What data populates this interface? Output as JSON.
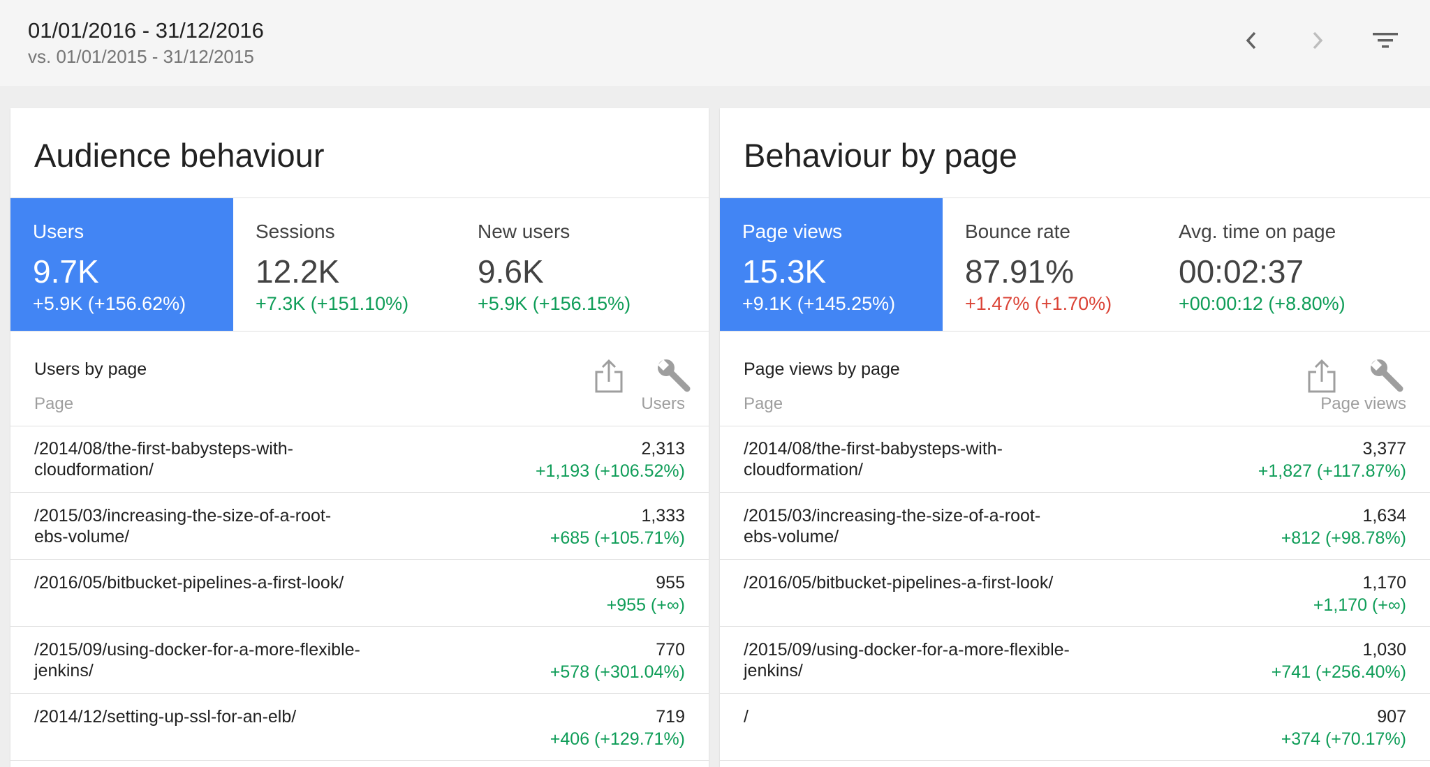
{
  "header": {
    "date_range": "01/01/2016 - 31/12/2016",
    "compare_range": "vs. 01/01/2015 - 31/12/2015",
    "icons": [
      "chevron-left-icon",
      "chevron-right-icon",
      "filter-icon"
    ]
  },
  "colors": {
    "accent": "#4285f4",
    "positive": "#0f9d58",
    "negative": "#db4437"
  },
  "audience": {
    "title": "Audience behaviour",
    "metrics": [
      {
        "label": "Users",
        "value": "9.7K",
        "delta": "+5.9K (+156.62%)"
      },
      {
        "label": "Sessions",
        "value": "12.2K",
        "delta": "+7.3K (+151.10%)"
      },
      {
        "label": "New users",
        "value": "9.6K",
        "delta": "+5.9K (+156.15%)"
      }
    ],
    "table": {
      "title": "Users by page",
      "col_left": "Page",
      "col_right": "Users",
      "rows": [
        {
          "page": "/2014/08/the-first-babysteps-with-cloudformation/",
          "value": "2,313",
          "delta": "+1,193 (+106.52%)"
        },
        {
          "page": "/2015/03/increasing-the-size-of-a-root-ebs-volume/",
          "value": "1,333",
          "delta": "+685 (+105.71%)"
        },
        {
          "page": "/2016/05/bitbucket-pipelines-a-first-look/",
          "value": "955",
          "delta": "+955 (+∞)"
        },
        {
          "page": "/2015/09/using-docker-for-a-more-flexible-jenkins/",
          "value": "770",
          "delta": "+578 (+301.04%)"
        },
        {
          "page": "/2014/12/setting-up-ssl-for-an-elb/",
          "value": "719",
          "delta": "+406 (+129.71%)"
        }
      ]
    }
  },
  "behaviour": {
    "title": "Behaviour by page",
    "metrics": [
      {
        "label": "Page views",
        "value": "15.3K",
        "delta": "+9.1K (+145.25%)"
      },
      {
        "label": "Bounce rate",
        "value": "87.91%",
        "delta": "+1.47% (+1.70%)"
      },
      {
        "label": "Avg. time on page",
        "value": "00:02:37",
        "delta": "+00:00:12 (+8.80%)"
      }
    ],
    "table": {
      "title": "Page views by page",
      "col_left": "Page",
      "col_right": "Page views",
      "rows": [
        {
          "page": "/2014/08/the-first-babysteps-with-cloudformation/",
          "value": "3,377",
          "delta": "+1,827 (+117.87%)"
        },
        {
          "page": "/2015/03/increasing-the-size-of-a-root-ebs-volume/",
          "value": "1,634",
          "delta": "+812 (+98.78%)"
        },
        {
          "page": "/2016/05/bitbucket-pipelines-a-first-look/",
          "value": "1,170",
          "delta": "+1,170 (+∞)"
        },
        {
          "page": "/2015/09/using-docker-for-a-more-flexible-jenkins/",
          "value": "1,030",
          "delta": "+741 (+256.40%)"
        },
        {
          "page": "/",
          "value": "907",
          "delta": "+374 (+70.17%)"
        }
      ]
    }
  }
}
